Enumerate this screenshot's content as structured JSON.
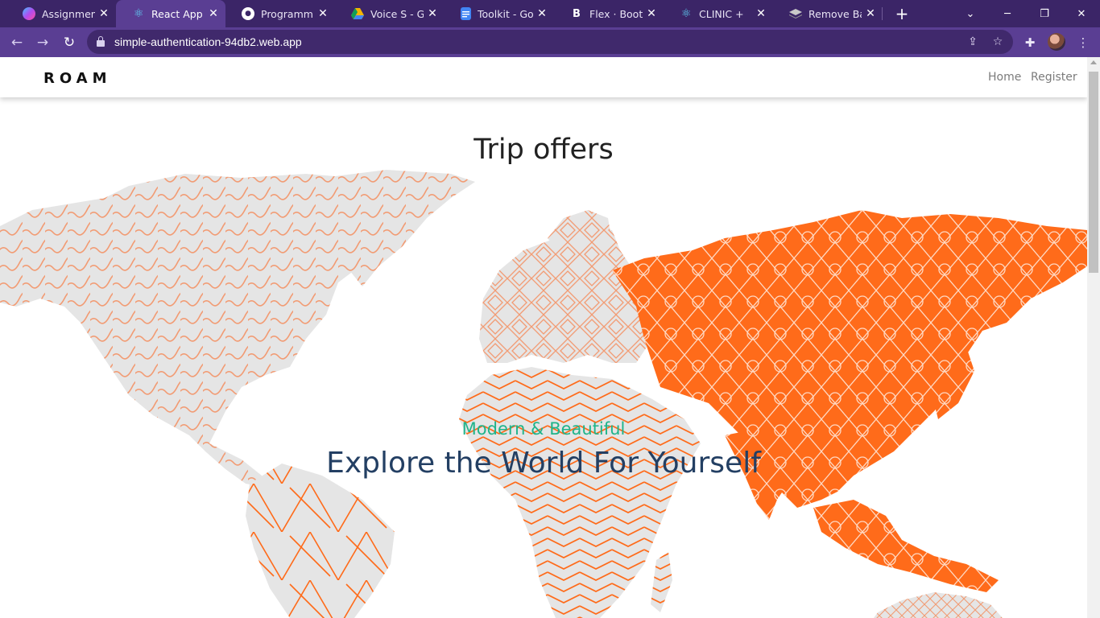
{
  "browser": {
    "tabs": [
      {
        "title": "Assignment -",
        "icon": "gradient-app-icon",
        "color": "#b04cf0"
      },
      {
        "title": "React App",
        "icon": "react-icon",
        "color": "#61dafb",
        "active": true
      },
      {
        "title": "Programming",
        "icon": "github-icon",
        "color": "#ffffff"
      },
      {
        "title": "Voice S - Goo",
        "icon": "google-drive-icon",
        "color": "#f4b400"
      },
      {
        "title": "Toolkit - Goo",
        "icon": "google-docs-icon",
        "color": "#4285f4"
      },
      {
        "title": "Flex · Bootstr",
        "icon": "bootstrap-icon",
        "color": "#ffffff"
      },
      {
        "title": "CLINIC +",
        "icon": "react-icon",
        "color": "#61dafb"
      },
      {
        "title": "Remove Back",
        "icon": "layers-icon",
        "color": "#cccccc"
      }
    ],
    "url": "simple-authentication-94db2.web.app"
  },
  "site": {
    "brand": "ROAM",
    "nav": {
      "home": "Home",
      "register": "Register"
    },
    "section_title": "Trip offers",
    "hero": {
      "subtitle": "Modern & Beautiful",
      "headline": "Explore the World For Yourself"
    }
  },
  "colors": {
    "accent_orange": "#ff6b1a",
    "land_grey": "#e5e5e5",
    "subtitle_green": "#1fb48a",
    "headline_navy": "#233f63",
    "browser_frame": "#3b2567",
    "toolbar": "#5a3e93"
  }
}
